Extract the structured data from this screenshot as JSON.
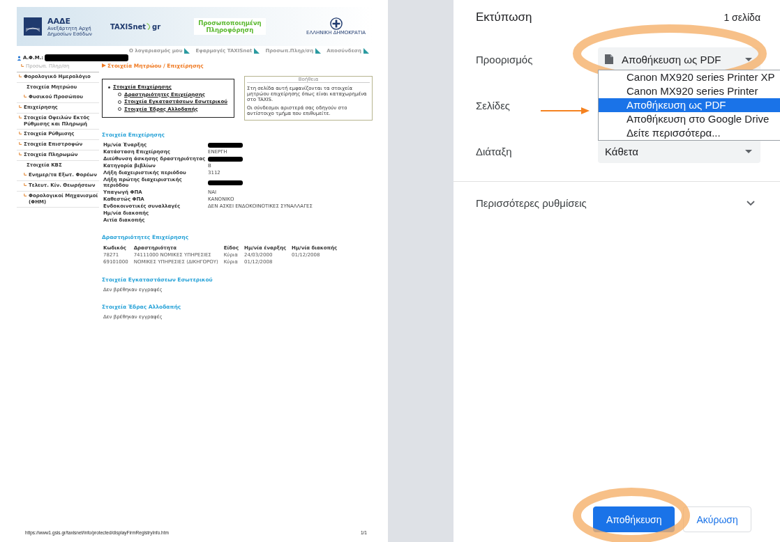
{
  "preview": {
    "header": {
      "agency": "ΑΑΔΕ",
      "agency_sub": [
        "Ανεξάρτητη Αρχή",
        "Δημοσίων Εσόδων"
      ],
      "taxisnet": "TAXISnet",
      "taxisnet_suffix": "gr",
      "title": [
        "Προσωποποιημένη",
        "Πληροφόρηση"
      ],
      "gov": "ΕΛΛΗΝΙΚΗ ΔΗΜΟΚΡΑΤΙΑ"
    },
    "top_links": [
      "Ο λογαριασμός μου",
      "Εφαρμογές TAXISnet",
      "Προσωπ.Πληρ/ση",
      "Αποσύνδεση"
    ],
    "user_label": "Α.Φ.Μ.:",
    "sidebar": [
      {
        "label": "Προσωπ. Πληρ/ση",
        "kind": "muted"
      },
      {
        "label": "Φορολογικό Ημερολόγιο",
        "kind": "arrow"
      },
      {
        "label": "Στοιχεία Μητρώου",
        "kind": "plain"
      },
      {
        "label": "Φυσικού Προσώπου",
        "kind": "sub"
      },
      {
        "label": "Επιχείρησης",
        "kind": "arrow"
      },
      {
        "label": "Στοιχεία Οφειλών Εκτός Ρύθμισης και Πληρωμή",
        "kind": "arrow"
      },
      {
        "label": "Στοιχεία Ρύθμισης",
        "kind": "arrow"
      },
      {
        "label": "Στοιχεία Επιστροφών",
        "kind": "arrow"
      },
      {
        "label": "Στοιχεία Πληρωμών",
        "kind": "arrow"
      },
      {
        "label": "Στοιχεία ΚΒΣ",
        "kind": "plain"
      },
      {
        "label": "Ενημερ/τα Εξωτ. Φορέων",
        "kind": "sub"
      },
      {
        "label": "Τελευτ. Κίν. Θεωρήσεων",
        "kind": "sub"
      },
      {
        "label": "Φορολογικοί Μηχανισμοί (ΦΗΜ)",
        "kind": "sub"
      }
    ],
    "breadcrumb": "Στοιχεία Μητρώου / Επιχείρησης",
    "toc": {
      "label": "Στοιχεία Επιχείρησης",
      "children": [
        {
          "label": "Δραστηριότητες Επιχείρησης"
        },
        {
          "label": "Στοιχεία Εγκαταστάσεων Εσωτερικού"
        },
        {
          "label": "Στοιχεία Έδρας Αλλοδαπής"
        }
      ]
    },
    "help": {
      "title": "Βοήθεια",
      "paragraphs": [
        "Στη σελίδα αυτή εμφανίζονται τα στοιχεία μητρώου επιχείρησης όπως είναι καταχωρημένα στο TAXIS.",
        "Οι σύνδεσμοι αριστερά σας οδηγούν στο αντίστοιχο τμήμα που επιθυμείτε."
      ]
    },
    "details_title": "Στοιχεία Επιχείρησης",
    "details": [
      {
        "label": "Ημ/νία Έναρξης",
        "redacted": true
      },
      {
        "label": "Κατάσταση Επιχείρησης",
        "value": "ΕΝΕΡΓΗ",
        "redacted": false
      },
      {
        "label": "Διεύθυνση άσκησης δραστηριότητας",
        "redacted": true
      },
      {
        "label": "Κατηγορία βιβλίων",
        "value": "Β",
        "redacted": false
      },
      {
        "label": "Λήξη διαχειριστικής περιόδου",
        "value": "3112",
        "redacted": false
      },
      {
        "label": "Λήξη πρώτης διαχειριστικής περιόδου",
        "redacted": true
      },
      {
        "label": "Υπαγωγή ΦΠΑ",
        "value": "ΝΑΙ",
        "redacted": false
      },
      {
        "label": "Καθεστώς ΦΠΑ",
        "value": "ΚΑΝΟΝΙΚΟ",
        "redacted": false
      },
      {
        "label": "Ενδοκοινοτικές συναλλαγές",
        "value": "ΔΕΝ ΑΣΚΕΙ ΕΝΔΟΚΟΙΝΟΤΙΚΕΣ ΣΥΝΑΛΛΑΓΕΣ",
        "redacted": false
      },
      {
        "label": "Ημ/νία διακοπής",
        "redacted": false
      },
      {
        "label": "Αιτία διακοπής",
        "redacted": false
      }
    ],
    "activities": {
      "title": "Δραστηριότητες Επιχείρησης",
      "columns": [
        "Κωδικός",
        "Δραστηριότητα",
        "Είδος",
        "Ημ/νία έναρξης",
        "Ημ/νία διακοπής"
      ],
      "rows": [
        [
          "78271",
          "74111000 ΝΟΜΙΚΕΣ ΥΠΗΡΕΣΙΕΣ",
          "Κύρια",
          "24/03/2000",
          "01/12/2008"
        ],
        [
          "69101000",
          "ΝΟΜΙΚΕΣ ΥΠΗΡΕΣΙΕΣ (ΔΙΚΗΓΟΡΟΥ)",
          "Κύρια",
          "01/12/2008"
        ]
      ]
    },
    "sections": [
      {
        "title": "Στοιχεία Εγκαταστάσεων Εσωτερικού",
        "text": "Δεν βρέθηκαν εγγραφές"
      },
      {
        "title": "Στοιχεία Έδρας Αλλοδαπής",
        "text": "Δεν βρέθηκαν εγγραφές"
      }
    ],
    "footer": {
      "url": "https://www1.gsis.gr/taxisnet/info/protected/displayFirmRegistryInfo.htm",
      "page": "1/1"
    }
  },
  "dialog": {
    "title": "Εκτύπωση",
    "page_count": "1 σελίδα",
    "destination": {
      "label": "Προορισμός",
      "value": "Αποθήκευση ως PDF",
      "expanded": true,
      "options": [
        {
          "label": "Canon MX920 series Printer XP",
          "selected": false
        },
        {
          "label": "Canon MX920 series Printer",
          "selected": false
        },
        {
          "label": "Αποθήκευση ως PDF",
          "selected": true
        },
        {
          "label": "Αποθήκευση στο Google Drive",
          "selected": false
        },
        {
          "label": "Δείτε περισσότερα...",
          "selected": false
        }
      ]
    },
    "pages": {
      "label": "Σελίδες"
    },
    "layout": {
      "label": "Διάταξη",
      "value": "Κάθετα"
    },
    "more_settings": {
      "label": "Περισσότερες ρυθμίσεις",
      "expanded": false
    },
    "buttons": [
      {
        "label": "Αποθήκευση",
        "kind": "primary"
      },
      {
        "label": "Ακύρωση",
        "kind": "secondary"
      }
    ]
  }
}
